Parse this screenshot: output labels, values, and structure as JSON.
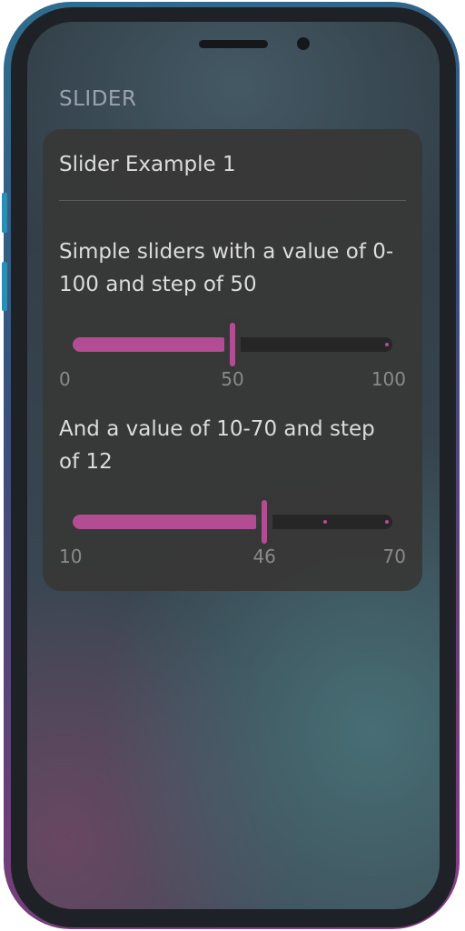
{
  "section": {
    "title": "SLIDER"
  },
  "card": {
    "title": "Slider Example 1",
    "sliders": [
      {
        "description": "Simple sliders with a value of 0-100 and step of 50",
        "min": 0,
        "max": 100,
        "step": 50,
        "value": 50,
        "min_label": "0",
        "value_label": "50",
        "max_label": "100"
      },
      {
        "description": "And a value of 10-70 and step of 12",
        "min": 10,
        "max": 70,
        "step": 12,
        "value": 46,
        "min_label": "10",
        "value_label": "46",
        "max_label": "70"
      }
    ]
  },
  "colors": {
    "accent": "#b24d93",
    "card_background": "#383838",
    "track": "#262626",
    "text": "#dcdcdc",
    "muted_text": "#8a8a8a",
    "frame_gradient_start": "#2e6e8e",
    "frame_gradient_end": "#8a3f8a"
  }
}
